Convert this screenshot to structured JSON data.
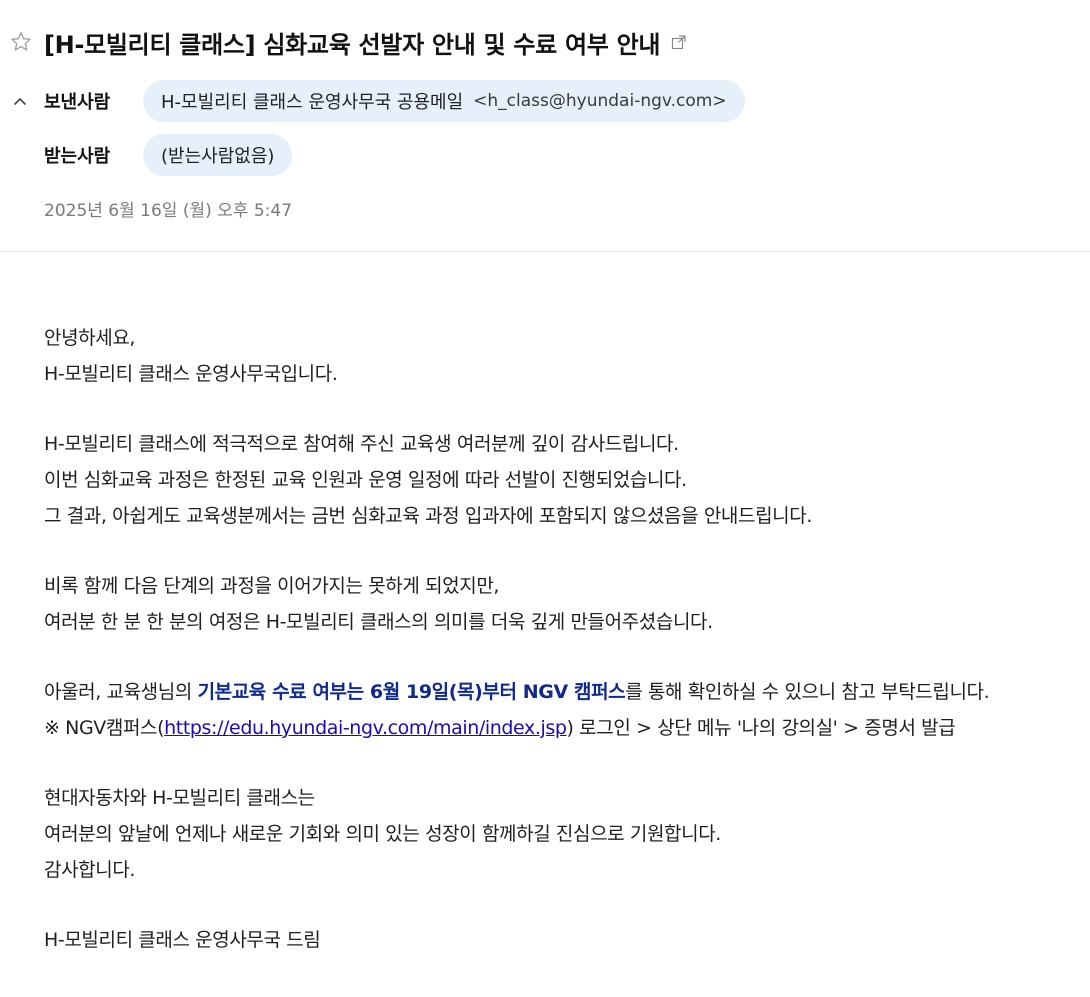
{
  "email": {
    "subject": "[H-모빌리티 클래스] 심화교육 선발자 안내 및 수료 여부 안내",
    "sender_label": "보낸사람",
    "sender_name": "H-모빌리티 클래스 운영사무국 공용메일",
    "sender_email": "<h_class@hyundai-ngv.com>",
    "recipient_label": "받는사람",
    "recipient_value": "(받는사람없음)",
    "date": "2025년 6월 16일 (월) 오후 5:47",
    "icons": {
      "star": "star-outline-icon",
      "external": "open-external-icon",
      "collapse": "chevron-up-icon"
    },
    "colors": {
      "chip_bg": "#e6f0fb",
      "highlight": "#0f2a8c",
      "link": "#1a0dab"
    }
  },
  "body": {
    "p1_l1": "안녕하세요,",
    "p1_l2": "H-모빌리티 클래스 운영사무국입니다.",
    "p2_l1": "H-모빌리티 클래스에 적극적으로 참여해 주신 교육생 여러분께 깊이 감사드립니다.",
    "p2_l2": "이번 심화교육 과정은 한정된 교육 인원과 운영 일정에 따라 선발이 진행되었습니다.",
    "p2_l3": "그 결과, 아쉽게도 교육생분께서는 금번 심화교육 과정 입과자에 포함되지 않으셨음을 안내드립니다.",
    "p3_l1": "비록 함께 다음 단계의 과정을 이어가지는 못하게 되었지만,",
    "p3_l2": "여러분 한 분 한 분의 여정은 H-모빌리티 클래스의 의미를 더욱 깊게 만들어주셨습니다.",
    "p4_l1_pre": "아울러, 교육생님의 ",
    "p4_l1_highlight": "기본교육 수료 여부는 6월 19일(목)부터 NGV 캠퍼스",
    "p4_l1_post": "를 통해 확인하실 수 있으니 참고 부탁드립니다.",
    "p4_l2_pre": "※ NGV캠퍼스(",
    "p4_l2_link": "https://edu.hyundai-ngv.com/main/index.jsp",
    "p4_l2_post": ") 로그인 > 상단 메뉴 '나의 강의실' > 증명서 발급",
    "p5_l1": "현대자동차와 H-모빌리티 클래스는",
    "p5_l2": "여러분의 앞날에 언제나 새로운 기회와 의미 있는 성장이 함께하길 진심으로 기원합니다.",
    "p5_l3": "감사합니다.",
    "p6_l1": "H-모빌리티 클래스 운영사무국 드림"
  }
}
